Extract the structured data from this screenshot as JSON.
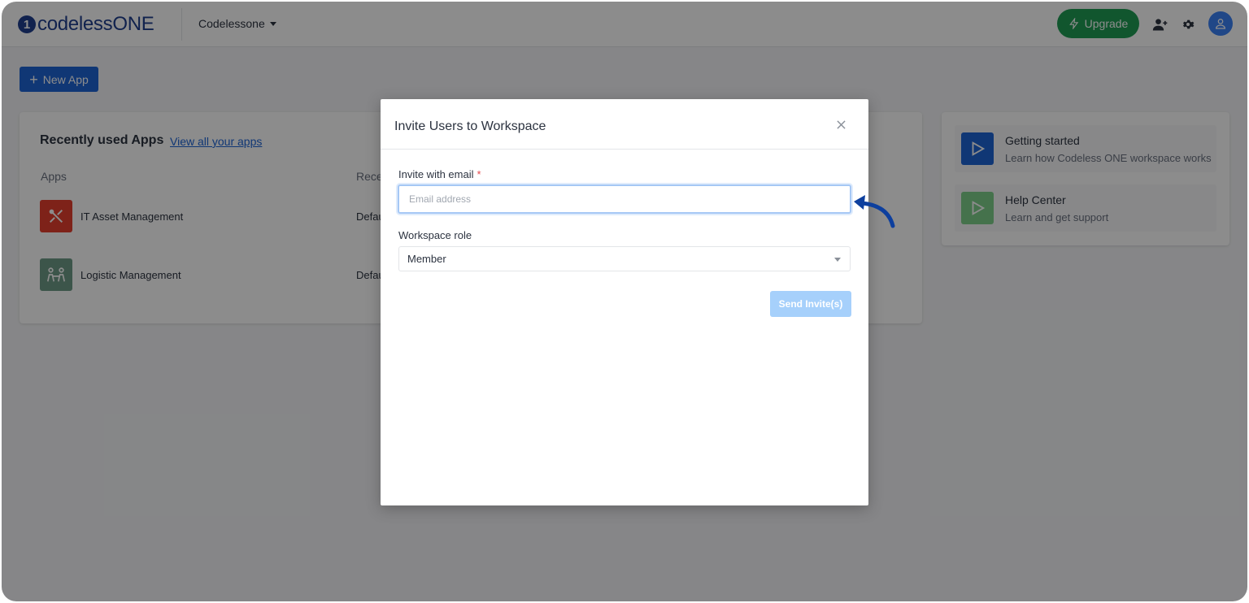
{
  "brand": {
    "logo_text": "codelessONE",
    "logo_mark": "1"
  },
  "header": {
    "workspace_name": "Codelessone",
    "upgrade_label": "Upgrade",
    "icons": [
      "add-user-icon",
      "gear-icon",
      "user-avatar-icon"
    ]
  },
  "toolbar": {
    "new_app_label": "New App"
  },
  "recent": {
    "title": "Recently used Apps",
    "view_all_label": "View all your apps",
    "columns": [
      "Apps",
      "Rece"
    ],
    "apps": [
      {
        "name": "IT Asset Management",
        "cell": "Defau",
        "icon": "tools-icon",
        "color": "#e53e2e"
      },
      {
        "name": "Logistic Management",
        "cell": "Defau",
        "icon": "people-icon",
        "color": "#6d9b87"
      }
    ]
  },
  "side": {
    "items": [
      {
        "title": "Getting started",
        "subtitle": "Learn how Codeless ONE workspace works",
        "icon": "play-icon",
        "color": "#1e64d6"
      },
      {
        "title": "Help Center",
        "subtitle": "Learn and get support",
        "icon": "play-icon",
        "color": "#7fd08a"
      }
    ]
  },
  "modal": {
    "title": "Invite Users to Workspace",
    "email_label": "Invite with email",
    "required_mark": "*",
    "email_placeholder": "Email address",
    "email_value": "",
    "role_label": "Workspace role",
    "role_value": "Member",
    "send_label": "Send Invite(s)"
  },
  "colors": {
    "brand": "#1f3f8f",
    "primary": "#1e64d6",
    "upgrade": "#1f9d55",
    "send_disabled": "#a6d0fb",
    "annotation_arrow": "#0d3f9e"
  }
}
